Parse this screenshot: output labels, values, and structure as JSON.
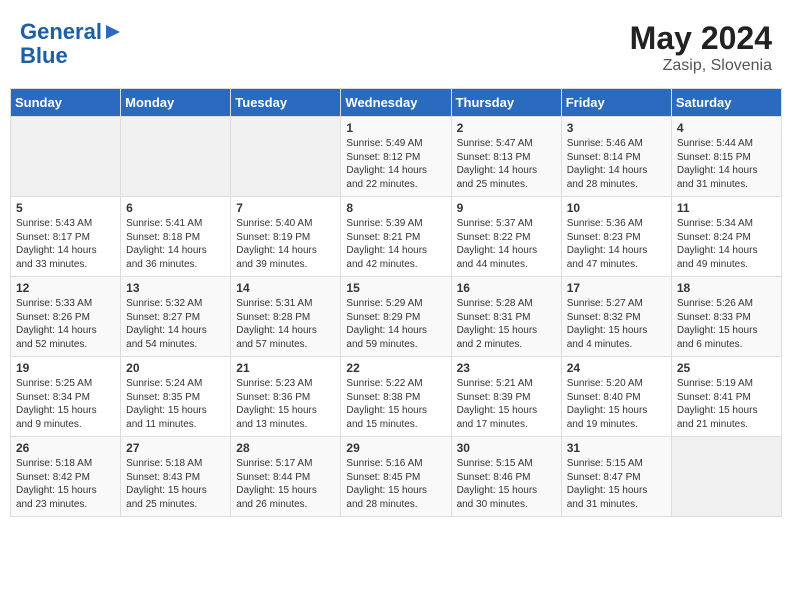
{
  "header": {
    "logo_line1": "General",
    "logo_line2": "Blue",
    "month_year": "May 2024",
    "location": "Zasip, Slovenia"
  },
  "weekdays": [
    "Sunday",
    "Monday",
    "Tuesday",
    "Wednesday",
    "Thursday",
    "Friday",
    "Saturday"
  ],
  "weeks": [
    [
      {
        "day": "",
        "info": ""
      },
      {
        "day": "",
        "info": ""
      },
      {
        "day": "",
        "info": ""
      },
      {
        "day": "1",
        "info": "Sunrise: 5:49 AM\nSunset: 8:12 PM\nDaylight: 14 hours\nand 22 minutes."
      },
      {
        "day": "2",
        "info": "Sunrise: 5:47 AM\nSunset: 8:13 PM\nDaylight: 14 hours\nand 25 minutes."
      },
      {
        "day": "3",
        "info": "Sunrise: 5:46 AM\nSunset: 8:14 PM\nDaylight: 14 hours\nand 28 minutes."
      },
      {
        "day": "4",
        "info": "Sunrise: 5:44 AM\nSunset: 8:15 PM\nDaylight: 14 hours\nand 31 minutes."
      }
    ],
    [
      {
        "day": "5",
        "info": "Sunrise: 5:43 AM\nSunset: 8:17 PM\nDaylight: 14 hours\nand 33 minutes."
      },
      {
        "day": "6",
        "info": "Sunrise: 5:41 AM\nSunset: 8:18 PM\nDaylight: 14 hours\nand 36 minutes."
      },
      {
        "day": "7",
        "info": "Sunrise: 5:40 AM\nSunset: 8:19 PM\nDaylight: 14 hours\nand 39 minutes."
      },
      {
        "day": "8",
        "info": "Sunrise: 5:39 AM\nSunset: 8:21 PM\nDaylight: 14 hours\nand 42 minutes."
      },
      {
        "day": "9",
        "info": "Sunrise: 5:37 AM\nSunset: 8:22 PM\nDaylight: 14 hours\nand 44 minutes."
      },
      {
        "day": "10",
        "info": "Sunrise: 5:36 AM\nSunset: 8:23 PM\nDaylight: 14 hours\nand 47 minutes."
      },
      {
        "day": "11",
        "info": "Sunrise: 5:34 AM\nSunset: 8:24 PM\nDaylight: 14 hours\nand 49 minutes."
      }
    ],
    [
      {
        "day": "12",
        "info": "Sunrise: 5:33 AM\nSunset: 8:26 PM\nDaylight: 14 hours\nand 52 minutes."
      },
      {
        "day": "13",
        "info": "Sunrise: 5:32 AM\nSunset: 8:27 PM\nDaylight: 14 hours\nand 54 minutes."
      },
      {
        "day": "14",
        "info": "Sunrise: 5:31 AM\nSunset: 8:28 PM\nDaylight: 14 hours\nand 57 minutes."
      },
      {
        "day": "15",
        "info": "Sunrise: 5:29 AM\nSunset: 8:29 PM\nDaylight: 14 hours\nand 59 minutes."
      },
      {
        "day": "16",
        "info": "Sunrise: 5:28 AM\nSunset: 8:31 PM\nDaylight: 15 hours\nand 2 minutes."
      },
      {
        "day": "17",
        "info": "Sunrise: 5:27 AM\nSunset: 8:32 PM\nDaylight: 15 hours\nand 4 minutes."
      },
      {
        "day": "18",
        "info": "Sunrise: 5:26 AM\nSunset: 8:33 PM\nDaylight: 15 hours\nand 6 minutes."
      }
    ],
    [
      {
        "day": "19",
        "info": "Sunrise: 5:25 AM\nSunset: 8:34 PM\nDaylight: 15 hours\nand 9 minutes."
      },
      {
        "day": "20",
        "info": "Sunrise: 5:24 AM\nSunset: 8:35 PM\nDaylight: 15 hours\nand 11 minutes."
      },
      {
        "day": "21",
        "info": "Sunrise: 5:23 AM\nSunset: 8:36 PM\nDaylight: 15 hours\nand 13 minutes."
      },
      {
        "day": "22",
        "info": "Sunrise: 5:22 AM\nSunset: 8:38 PM\nDaylight: 15 hours\nand 15 minutes."
      },
      {
        "day": "23",
        "info": "Sunrise: 5:21 AM\nSunset: 8:39 PM\nDaylight: 15 hours\nand 17 minutes."
      },
      {
        "day": "24",
        "info": "Sunrise: 5:20 AM\nSunset: 8:40 PM\nDaylight: 15 hours\nand 19 minutes."
      },
      {
        "day": "25",
        "info": "Sunrise: 5:19 AM\nSunset: 8:41 PM\nDaylight: 15 hours\nand 21 minutes."
      }
    ],
    [
      {
        "day": "26",
        "info": "Sunrise: 5:18 AM\nSunset: 8:42 PM\nDaylight: 15 hours\nand 23 minutes."
      },
      {
        "day": "27",
        "info": "Sunrise: 5:18 AM\nSunset: 8:43 PM\nDaylight: 15 hours\nand 25 minutes."
      },
      {
        "day": "28",
        "info": "Sunrise: 5:17 AM\nSunset: 8:44 PM\nDaylight: 15 hours\nand 26 minutes."
      },
      {
        "day": "29",
        "info": "Sunrise: 5:16 AM\nSunset: 8:45 PM\nDaylight: 15 hours\nand 28 minutes."
      },
      {
        "day": "30",
        "info": "Sunrise: 5:15 AM\nSunset: 8:46 PM\nDaylight: 15 hours\nand 30 minutes."
      },
      {
        "day": "31",
        "info": "Sunrise: 5:15 AM\nSunset: 8:47 PM\nDaylight: 15 hours\nand 31 minutes."
      },
      {
        "day": "",
        "info": ""
      }
    ]
  ]
}
